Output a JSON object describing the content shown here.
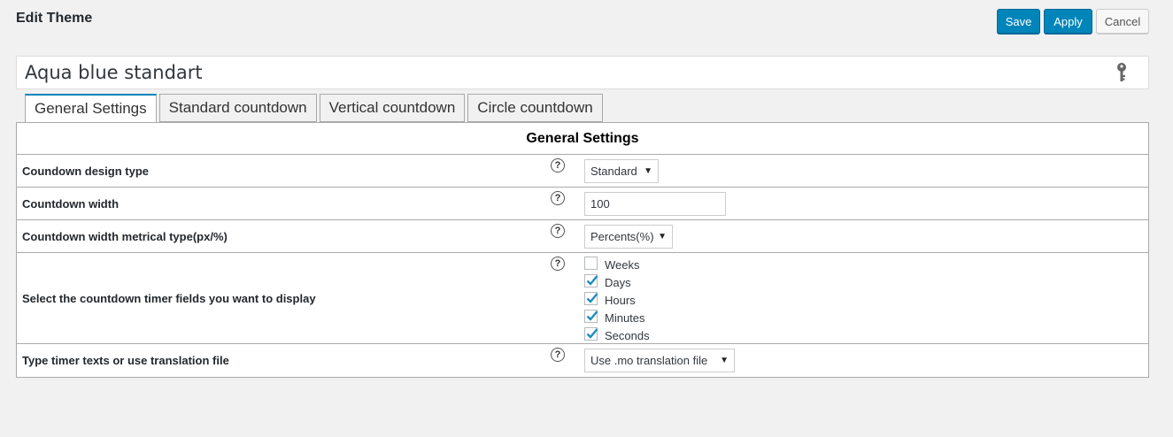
{
  "header": {
    "title": "Edit Theme"
  },
  "actions": {
    "save": "Save",
    "apply": "Apply",
    "cancel": "Cancel"
  },
  "theme": {
    "name": "Aqua blue standart"
  },
  "tabs": [
    {
      "label": "General Settings",
      "active": true
    },
    {
      "label": "Standard countdown",
      "active": false
    },
    {
      "label": "Vertical countdown",
      "active": false
    },
    {
      "label": "Circle countdown",
      "active": false
    }
  ],
  "panel": {
    "heading": "General Settings",
    "help_glyph": "?",
    "rows": {
      "design_type": {
        "label": "Coundown design type",
        "value": "Standard"
      },
      "width": {
        "label": "Countdown width",
        "value": "100"
      },
      "width_type": {
        "label": "Countdown width metrical type(px/%)",
        "value": "Percents(%)"
      },
      "fields": {
        "label": "Select the countdown timer fields you want to display",
        "options": [
          {
            "label": "Weeks",
            "checked": false
          },
          {
            "label": "Days",
            "checked": true
          },
          {
            "label": "Hours",
            "checked": true
          },
          {
            "label": "Minutes",
            "checked": true
          },
          {
            "label": "Seconds",
            "checked": true
          }
        ]
      },
      "texts": {
        "label": "Type timer texts or use translation file",
        "value": "Use .mo translation file"
      }
    }
  },
  "colors": {
    "primary": "#0085ba",
    "check": "#1e8cbe"
  },
  "icons": {
    "key": "key-icon",
    "help": "help-icon",
    "dropdown": "caret-down-icon",
    "check": "checkmark-icon"
  }
}
